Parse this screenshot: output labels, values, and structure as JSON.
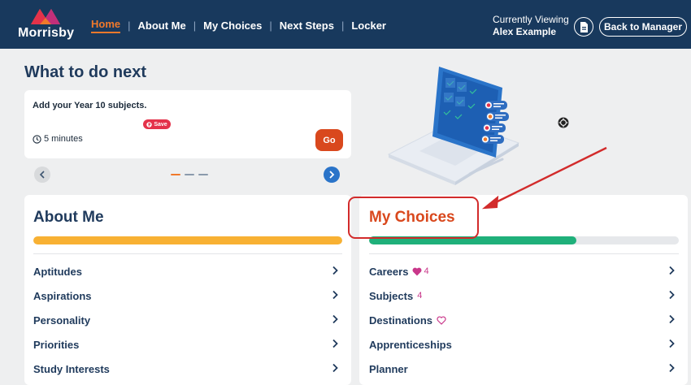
{
  "app": {
    "logo_text": "Morrisby"
  },
  "nav": {
    "items": [
      {
        "label": "Home",
        "active": true
      },
      {
        "label": "About Me"
      },
      {
        "label": "My Choices"
      },
      {
        "label": "Next Steps"
      },
      {
        "label": "Locker"
      }
    ],
    "separator": "|"
  },
  "header": {
    "viewing_label": "Currently Viewing",
    "viewing_name": "Alex Example",
    "doc_icon": "document-icon",
    "back_label": "Back to Manager"
  },
  "what_next": {
    "heading": "What to do next",
    "task_title": "Add your Year 10 subjects.",
    "save_label": "Save",
    "duration": "5 minutes",
    "go_label": "Go",
    "carousel_count": 3,
    "carousel_active": 0
  },
  "about_me": {
    "title": "About Me",
    "progress": 1.0,
    "items": [
      {
        "label": "Aptitudes"
      },
      {
        "label": "Aspirations"
      },
      {
        "label": "Personality"
      },
      {
        "label": "Priorities"
      },
      {
        "label": "Study Interests"
      }
    ]
  },
  "my_choices": {
    "title": "My Choices",
    "progress": 0.67,
    "items": [
      {
        "label": "Careers",
        "heart": "filled",
        "count": "4"
      },
      {
        "label": "Subjects",
        "count": "4"
      },
      {
        "label": "Destinations",
        "heart": "outline"
      },
      {
        "label": "Apprenticeships"
      },
      {
        "label": "Planner"
      }
    ]
  },
  "colors": {
    "nav_bg": "#18395d",
    "accent_orange": "#f0792b",
    "go_button": "#d9481d",
    "about_progress": "#f8b133",
    "choices_progress": "#1fb07a",
    "annotation_red": "#d22b2b",
    "heart_pink": "#c9378a"
  }
}
